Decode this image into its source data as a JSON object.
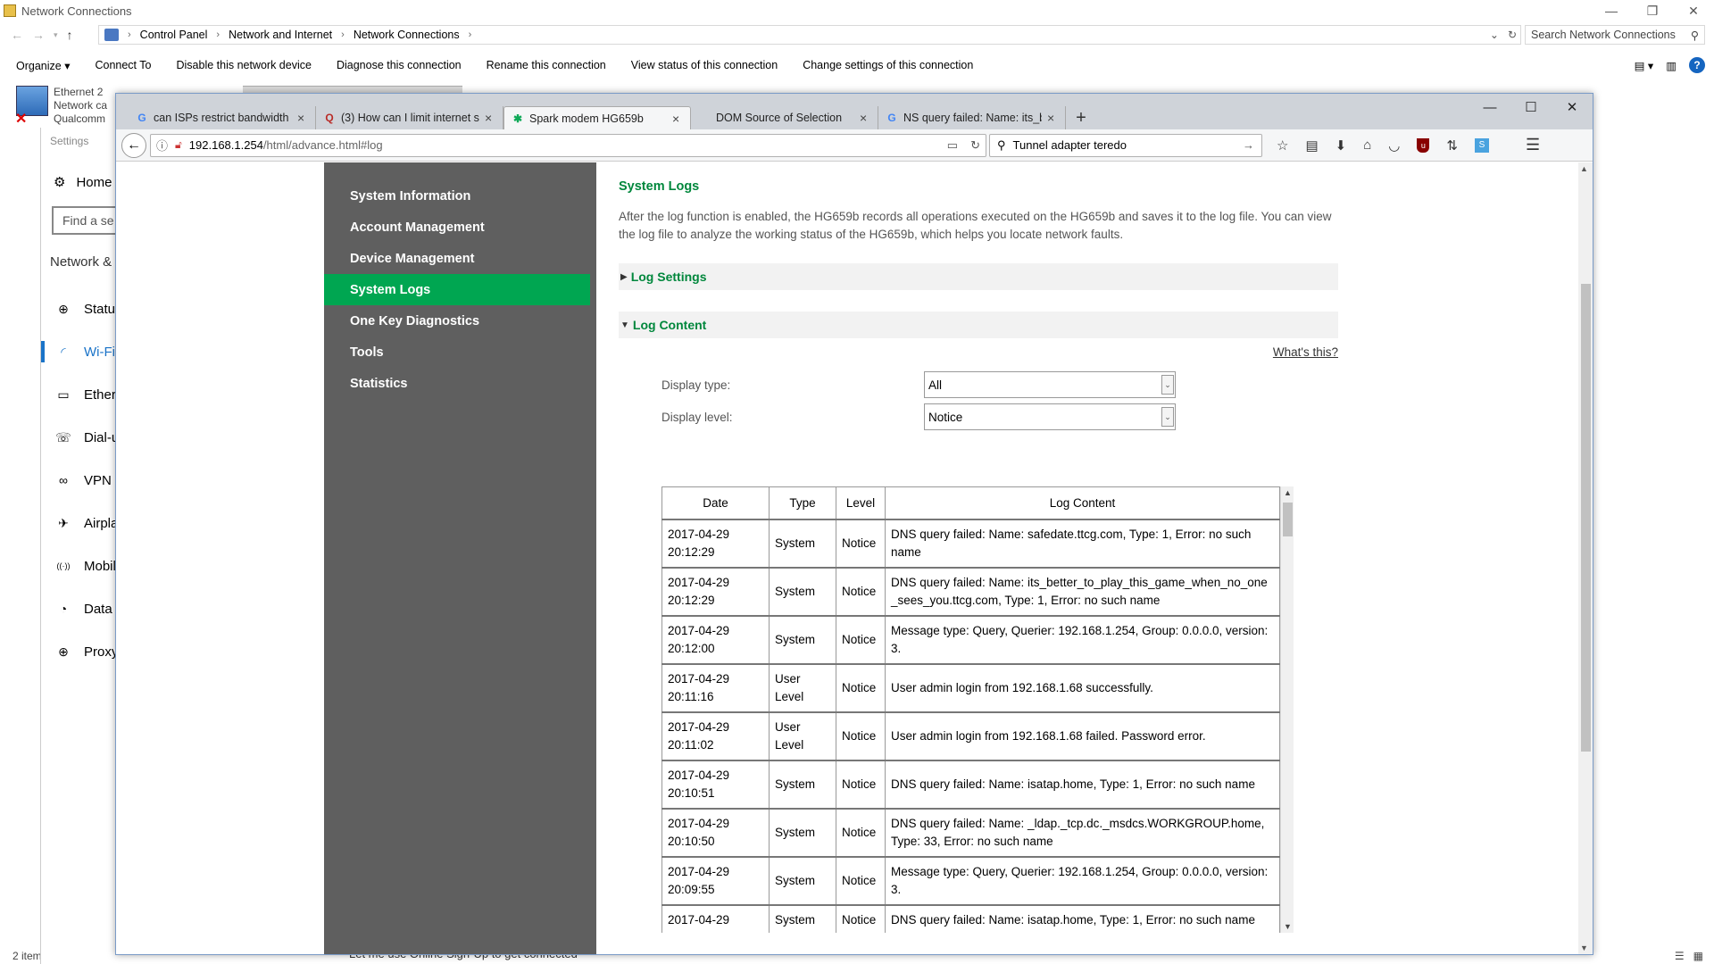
{
  "explorer": {
    "title": "Network Connections",
    "breadcrumb": [
      "Control Panel",
      "Network and Internet",
      "Network Connections"
    ],
    "search_placeholder": "Search Network Connections",
    "toolbar": [
      "Organize ▾",
      "Connect To",
      "Disable this network device",
      "Diagnose this connection",
      "Rename this connection",
      "View status of this connection",
      "Change settings of this connection"
    ],
    "item": {
      "name": "Ethernet 2",
      "line2": "Network ca",
      "line3": "Qualcomm"
    },
    "status": "2 item"
  },
  "settings": {
    "title": "Settings",
    "home": "Home",
    "find_placeholder": "Find a se",
    "category": "Network &",
    "nav": [
      {
        "icon": "⊕",
        "label": "Status"
      },
      {
        "icon": "◜",
        "label": "Wi-Fi"
      },
      {
        "icon": "▭",
        "label": "Ethern"
      },
      {
        "icon": "☏",
        "label": "Dial-u"
      },
      {
        "icon": "∞",
        "label": "VPN"
      },
      {
        "icon": "✈",
        "label": "Airpla"
      },
      {
        "icon": "((·))",
        "label": "Mobil"
      },
      {
        "icon": "◔",
        "label": "Data u"
      },
      {
        "icon": "⊕",
        "label": "Proxy"
      }
    ],
    "bottom_text": "Let me use Online Sign-Up to get connected"
  },
  "browser": {
    "tabs": [
      {
        "favicon": "G",
        "favicon_color": "#4285f4",
        "label": "can ISPs restrict bandwidth o"
      },
      {
        "favicon": "Q",
        "favicon_color": "#b92b27",
        "label": "(3) How can I limit internet s"
      },
      {
        "favicon": "✱",
        "favicon_color": "#0fa958",
        "label": "Spark modem HG659b"
      },
      {
        "favicon": "",
        "favicon_color": "#666",
        "label": "DOM Source of Selection"
      },
      {
        "favicon": "G",
        "favicon_color": "#4285f4",
        "label": "NS query failed: Name: its_b"
      }
    ],
    "url_host": "192.168.1.254",
    "url_path": "/html/advance.html#log",
    "search_value": "Tunnel adapter teredo"
  },
  "router": {
    "sidebar": [
      "System Information",
      "Account Management",
      "Device Management",
      "System Logs",
      "One Key Diagnostics",
      "Tools",
      "Statistics"
    ],
    "active_index": 3,
    "title": "System Logs",
    "intro": "After the log function is enabled, the HG659b records all operations executed on the HG659b and saves it to the log file. You can view the log file to analyze the working status of the HG659b, which helps you locate network faults.",
    "log_settings_label": "Log Settings",
    "log_content_label": "Log Content",
    "whats_this": "What's this?",
    "display_type_label": "Display type:",
    "display_type_value": "All",
    "display_level_label": "Display level:",
    "display_level_value": "Notice",
    "table_headers": [
      "Date",
      "Type",
      "Level",
      "Log Content"
    ],
    "rows": [
      {
        "date": "2017-04-29 20:12:29",
        "type": "System",
        "level": "Notice",
        "content": "DNS query failed: Name: safedate.ttcg.com, Type: 1, Error: no such name"
      },
      {
        "date": "2017-04-29 20:12:29",
        "type": "System",
        "level": "Notice",
        "content": "DNS query failed: Name: its_better_to_play_this_game_when_no_one_sees_you.ttcg.com, Type: 1, Error: no such name"
      },
      {
        "date": "2017-04-29 20:12:00",
        "type": "System",
        "level": "Notice",
        "content": "Message type: Query, Querier: 192.168.1.254, Group: 0.0.0.0, version: 3."
      },
      {
        "date": "2017-04-29 20:11:16",
        "type": "User Level",
        "level": "Notice",
        "content": "User admin login from 192.168.1.68 successfully."
      },
      {
        "date": "2017-04-29 20:11:02",
        "type": "User Level",
        "level": "Notice",
        "content": "User admin login from 192.168.1.68 failed. Password error."
      },
      {
        "date": "2017-04-29 20:10:51",
        "type": "System",
        "level": "Notice",
        "content": "DNS query failed: Name: isatap.home, Type: 1, Error: no such name"
      },
      {
        "date": "2017-04-29 20:10:50",
        "type": "System",
        "level": "Notice",
        "content": "DNS query failed: Name: _ldap._tcp.dc._msdcs.WORKGROUP.home, Type: 33, Error: no such name"
      },
      {
        "date": "2017-04-29 20:09:55",
        "type": "System",
        "level": "Notice",
        "content": "Message type: Query, Querier: 192.168.1.254, Group: 0.0.0.0, version: 3."
      },
      {
        "date": "2017-04-29",
        "type": "System",
        "level": "Notice",
        "content": "DNS query failed: Name: isatap.home, Type: 1, Error: no such name"
      }
    ]
  }
}
